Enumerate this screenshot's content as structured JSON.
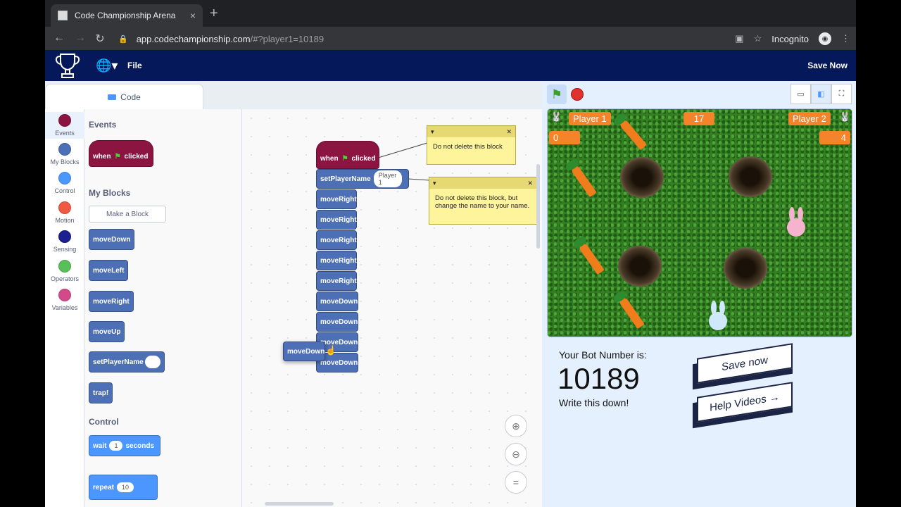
{
  "browser": {
    "tab_title": "Code Championship Arena",
    "tab_close": "×",
    "new_tab": "+",
    "url_host": "app.codechampionship.com",
    "url_rest": "/#?player1=10189",
    "incognito_label": "Incognito"
  },
  "header": {
    "file_menu": "File",
    "save_now": "Save Now"
  },
  "editor": {
    "code_tab": "Code",
    "categories": [
      {
        "label": "Events",
        "color": "#8b1440"
      },
      {
        "label": "My Blocks",
        "color": "#4c6fb5"
      },
      {
        "label": "Control",
        "color": "#4c97ff"
      },
      {
        "label": "Motion",
        "color": "#f05a43"
      },
      {
        "label": "Sensing",
        "color": "#1b1f8f"
      },
      {
        "label": "Operators",
        "color": "#59c059"
      },
      {
        "label": "Variables",
        "color": "#d34a8b"
      }
    ],
    "palette": {
      "events_heading": "Events",
      "when_label": "when",
      "clicked_label": "clicked",
      "myblocks_heading": "My Blocks",
      "make_block": "Make a Block",
      "blocks": [
        "moveDown",
        "moveLeft",
        "moveRight",
        "moveUp",
        "setPlayerName",
        "trap!"
      ],
      "control_heading": "Control",
      "wait_label": "wait",
      "wait_value": "1",
      "seconds_label": "seconds",
      "repeat_label": "repeat",
      "repeat_value": "10"
    },
    "workspace": {
      "hat_when": "when",
      "hat_clicked": "clicked",
      "set_name_block": "setPlayerName",
      "set_name_value": "Player 1",
      "stack": [
        "moveRight",
        "moveRight",
        "moveRight",
        "moveRight",
        "moveRight",
        "moveDown",
        "moveDown",
        "moveDown",
        "moveDown"
      ],
      "dragging_block": "moveDown",
      "note1": "Do not delete this block",
      "note2": "Do not delete this block, but change the name to your name."
    }
  },
  "stage": {
    "player1_label": "Player 1",
    "player1_score": "0",
    "timer": "17",
    "player2_label": "Player 2",
    "player2_score": "4"
  },
  "info": {
    "bot_number_label": "Your Bot Number is:",
    "bot_number": "10189",
    "write_down": "Write this down!",
    "save_now_button": "Save now",
    "help_videos_button": "Help Videos →"
  }
}
